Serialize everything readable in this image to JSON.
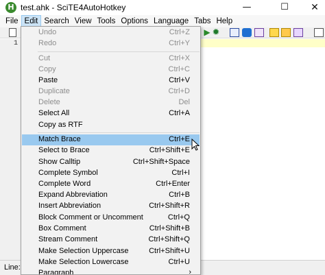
{
  "window": {
    "icon_letter": "H",
    "title": "test.ahk - SciTE4AutoHotkey",
    "minimize": "—",
    "maximize": "☐",
    "close": "✕"
  },
  "menubar": {
    "items": [
      {
        "label": "File",
        "active": false
      },
      {
        "label": "Edit",
        "active": true
      },
      {
        "label": "Search",
        "active": false
      },
      {
        "label": "View",
        "active": false
      },
      {
        "label": "Tools",
        "active": false
      },
      {
        "label": "Options",
        "active": false
      },
      {
        "label": "Language",
        "active": false
      },
      {
        "label": "Tabs",
        "active": false
      },
      {
        "label": "Help",
        "active": false
      }
    ]
  },
  "editor": {
    "line_number": "1"
  },
  "statusbar": {
    "text": "Line:"
  },
  "edit_menu": {
    "items": [
      {
        "label": "Undo",
        "shortcut": "Ctrl+Z",
        "disabled": true
      },
      {
        "label": "Redo",
        "shortcut": "Ctrl+Y",
        "disabled": true
      },
      {
        "label": "Cut",
        "shortcut": "Ctrl+X",
        "disabled": true
      },
      {
        "label": "Copy",
        "shortcut": "Ctrl+C",
        "disabled": true
      },
      {
        "label": "Paste",
        "shortcut": "Ctrl+V",
        "disabled": false
      },
      {
        "label": "Duplicate",
        "shortcut": "Ctrl+D",
        "disabled": true
      },
      {
        "label": "Delete",
        "shortcut": "Del",
        "disabled": true
      },
      {
        "label": "Select All",
        "shortcut": "Ctrl+A",
        "disabled": false
      },
      {
        "label": "Copy as RTF",
        "shortcut": "",
        "disabled": false
      },
      {
        "label": "Match Brace",
        "shortcut": "Ctrl+E",
        "disabled": false,
        "highlight": true
      },
      {
        "label": "Select to Brace",
        "shortcut": "Ctrl+Shift+E",
        "disabled": false
      },
      {
        "label": "Show Calltip",
        "shortcut": "Ctrl+Shift+Space",
        "disabled": false
      },
      {
        "label": "Complete Symbol",
        "shortcut": "Ctrl+I",
        "disabled": false
      },
      {
        "label": "Complete Word",
        "shortcut": "Ctrl+Enter",
        "disabled": false
      },
      {
        "label": "Expand Abbreviation",
        "shortcut": "Ctrl+B",
        "disabled": false
      },
      {
        "label": "Insert Abbreviation",
        "shortcut": "Ctrl+Shift+R",
        "disabled": false
      },
      {
        "label": "Block Comment or Uncomment",
        "shortcut": "Ctrl+Q",
        "disabled": false
      },
      {
        "label": "Box Comment",
        "shortcut": "Ctrl+Shift+B",
        "disabled": false
      },
      {
        "label": "Stream Comment",
        "shortcut": "Ctrl+Shift+Q",
        "disabled": false
      },
      {
        "label": "Make Selection Uppercase",
        "shortcut": "Ctrl+Shift+U",
        "disabled": false
      },
      {
        "label": "Make Selection Lowercase",
        "shortcut": "Ctrl+U",
        "disabled": false
      },
      {
        "label": "Paragraph",
        "shortcut": "",
        "disabled": false,
        "submenu": true
      }
    ]
  },
  "icons": {
    "toolbar": [
      "new-file-icon",
      "run-icon",
      "settings-icon",
      "toolbox-icon-1",
      "toolbox-icon-2",
      "toolbox-icon-3",
      "folder-icon-1",
      "folder-icon-2",
      "tool-icon",
      "new-file-icon-2"
    ]
  },
  "colors": {
    "highlight": "#99c9ef",
    "menu_active": "#cce4f7",
    "current_line": "#ffffc8",
    "app_icon": "#3a8a2e"
  }
}
